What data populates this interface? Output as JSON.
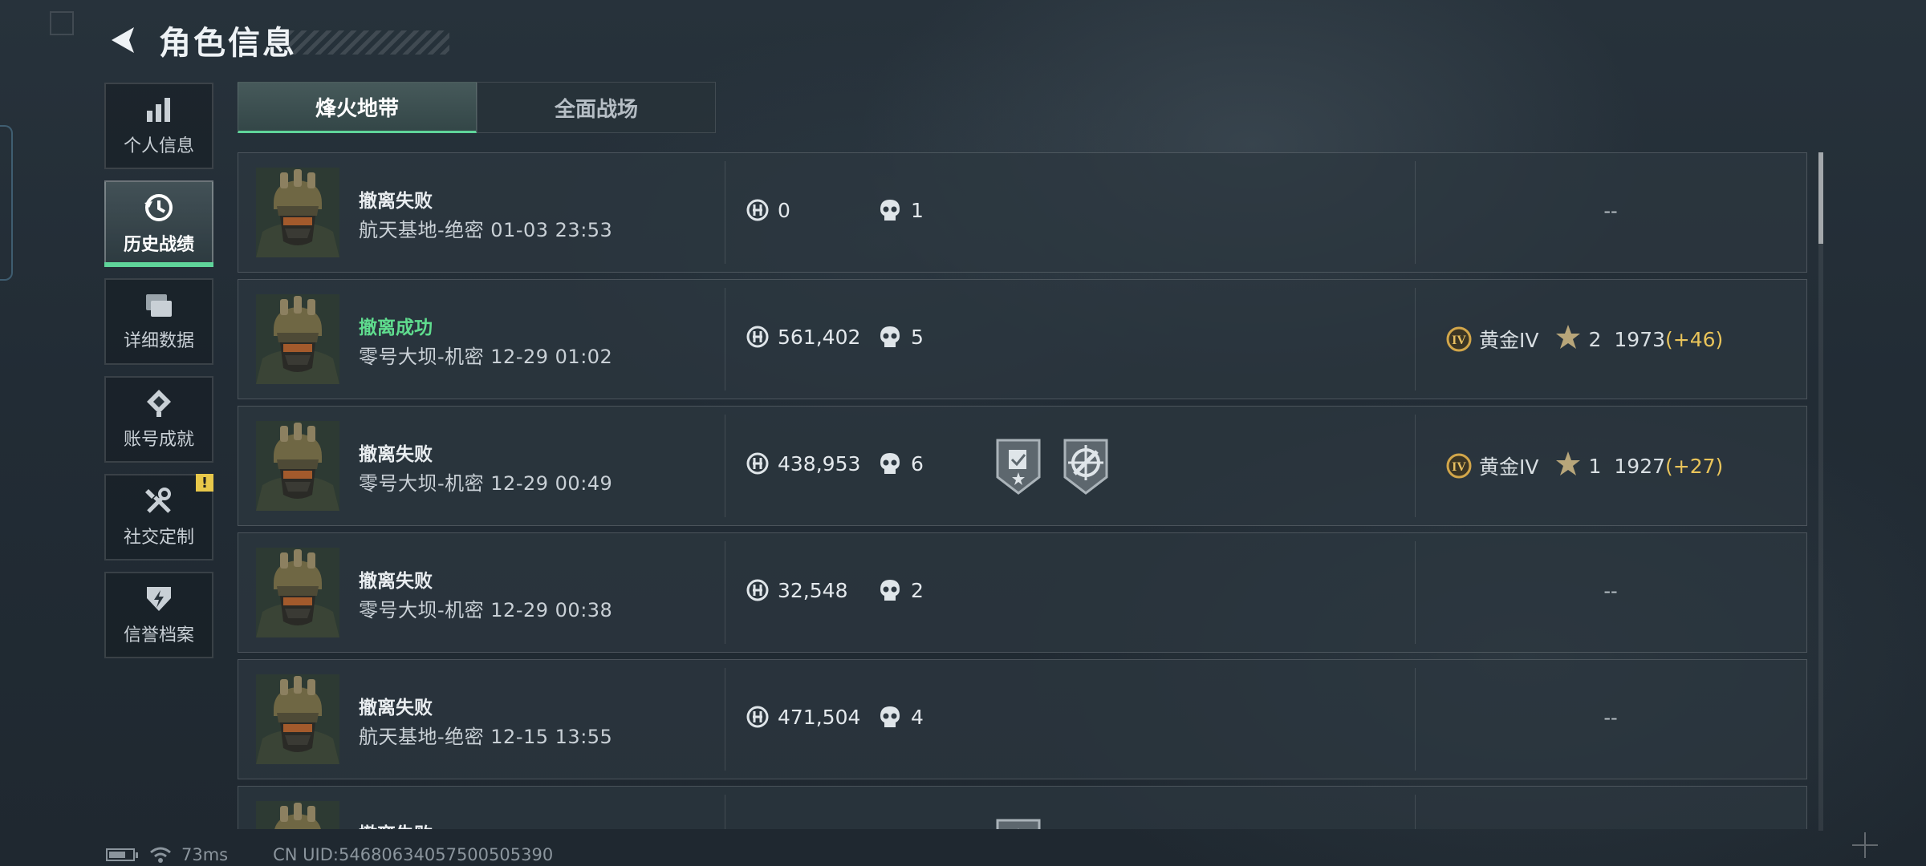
{
  "header": {
    "title": "角色信息"
  },
  "sidebar": {
    "items": [
      {
        "label": "个人信息",
        "icon": "bar-chart-icon",
        "active": false
      },
      {
        "label": "历史战绩",
        "icon": "history-icon",
        "active": true
      },
      {
        "label": "详细数据",
        "icon": "cards-icon",
        "active": false
      },
      {
        "label": "账号成就",
        "icon": "achievement-icon",
        "active": false
      },
      {
        "label": "社交定制",
        "icon": "tools-icon",
        "active": false,
        "badge": "!"
      },
      {
        "label": "信誉档案",
        "icon": "credit-icon",
        "active": false
      }
    ]
  },
  "tabs": [
    {
      "label": "烽火地带",
      "active": true
    },
    {
      "label": "全面战场",
      "active": false
    }
  ],
  "records": [
    {
      "status": "撤离失败",
      "success": false,
      "map_time": "航天基地-绝密 01-03 23:53",
      "value": "0",
      "kills": "1",
      "medals": [],
      "rank": null,
      "dash": "--"
    },
    {
      "status": "撤离成功",
      "success": true,
      "map_time": "零号大坝-机密 12-29 01:02",
      "value": "561,402",
      "kills": "5",
      "medals": [],
      "rank": {
        "tier": "黄金IV",
        "stars": "2",
        "score": "1973",
        "delta": "(+46)"
      }
    },
    {
      "status": "撤离失败",
      "success": false,
      "map_time": "零号大坝-机密 12-29 00:49",
      "value": "438,953",
      "kills": "6",
      "medals": [
        "task-medal-icon",
        "target-medal-icon"
      ],
      "rank": {
        "tier": "黄金IV",
        "stars": "1",
        "score": "1927",
        "delta": "(+27)"
      }
    },
    {
      "status": "撤离失败",
      "success": false,
      "map_time": "零号大坝-机密 12-29 00:38",
      "value": "32,548",
      "kills": "2",
      "medals": [],
      "rank": null,
      "dash": "--"
    },
    {
      "status": "撤离失败",
      "success": false,
      "map_time": "航天基地-绝密 12-15 13:55",
      "value": "471,504",
      "kills": "4",
      "medals": [],
      "rank": null,
      "dash": "--"
    },
    {
      "status": "撤离失败",
      "success": false,
      "map_time": "",
      "value": "",
      "kills": "",
      "medals": [
        "star-medal-icon"
      ],
      "rank": null,
      "dash": ""
    }
  ],
  "footer": {
    "battery_level": 0.7,
    "ping": "73ms",
    "uid": "CN UID:54680634057500505390"
  },
  "colors": {
    "success": "#5fdc8e",
    "accent": "#5fd49a",
    "rank_delta": "#e9c45a",
    "warning_badge": "#e8c84a"
  }
}
